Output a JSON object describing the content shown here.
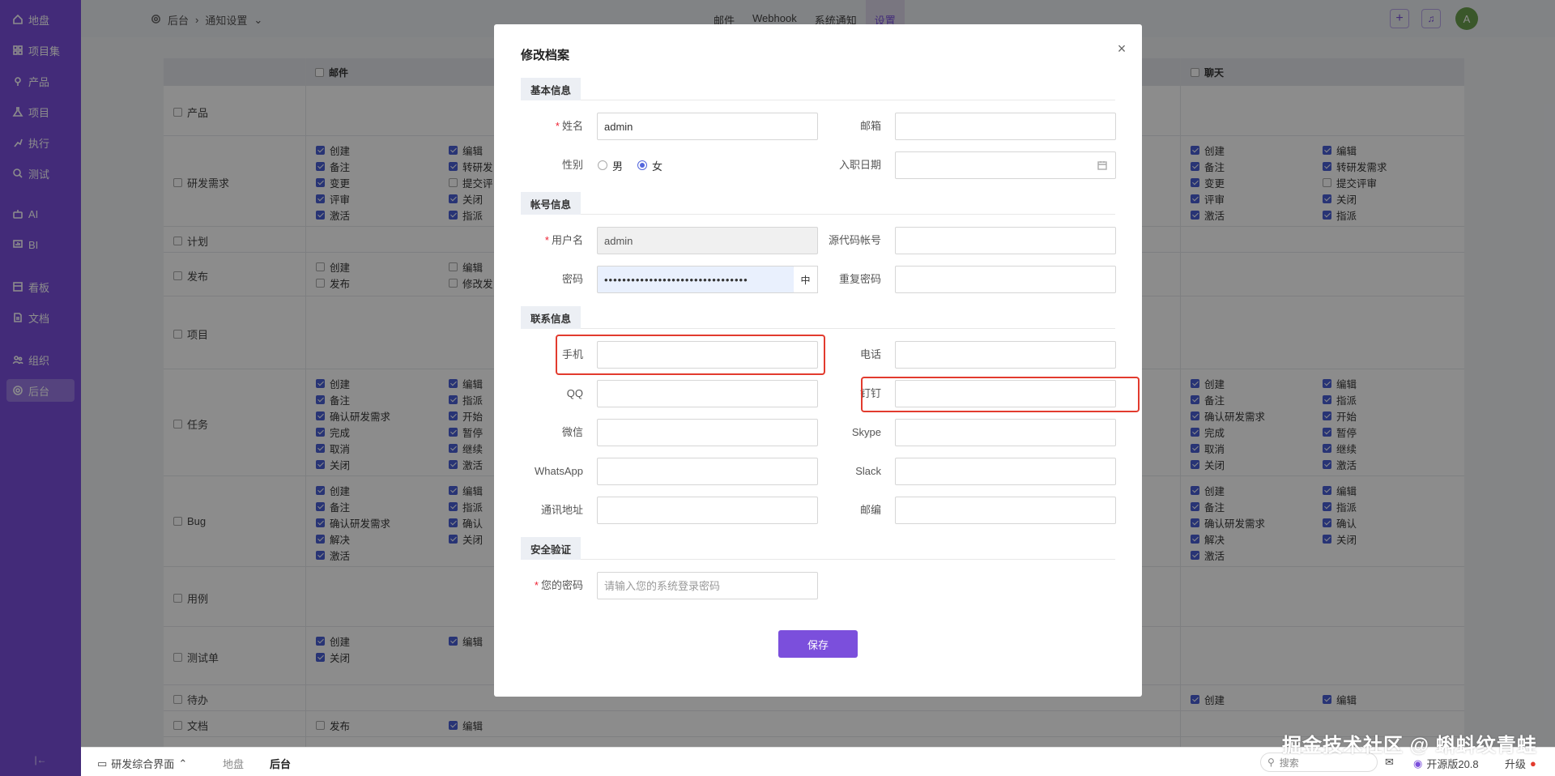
{
  "sidebar": {
    "items": [
      {
        "label": "地盘",
        "icon": "home-icon"
      },
      {
        "label": "项目集",
        "icon": "grid-icon"
      },
      {
        "label": "产品",
        "icon": "pin-icon"
      },
      {
        "label": "项目",
        "icon": "flask-icon"
      },
      {
        "label": "执行",
        "icon": "run-icon"
      },
      {
        "label": "测试",
        "icon": "search-icon"
      },
      {
        "label": "AI",
        "icon": "robot-icon"
      },
      {
        "label": "BI",
        "icon": "chart-icon"
      },
      {
        "label": "看板",
        "icon": "board-icon"
      },
      {
        "label": "文档",
        "icon": "doc-icon"
      },
      {
        "label": "组织",
        "icon": "users-icon"
      },
      {
        "label": "后台",
        "icon": "gear-icon"
      }
    ],
    "collapse": "|←"
  },
  "header": {
    "breadcrumb_root": "后台",
    "breadcrumb_current": "通知设置",
    "tabs": [
      "邮件",
      "Webhook",
      "系统通知",
      "设置"
    ],
    "avatar": "A"
  },
  "matrix": {
    "columns": [
      "邮件",
      "聊天"
    ],
    "rows": [
      {
        "label": "产品"
      },
      {
        "label": "研发需求"
      },
      {
        "label": "计划"
      },
      {
        "label": "发布"
      },
      {
        "label": "项目"
      },
      {
        "label": "任务"
      },
      {
        "label": "Bug"
      },
      {
        "label": "用例"
      },
      {
        "label": "测试单"
      },
      {
        "label": "待办"
      },
      {
        "label": "文档"
      }
    ],
    "story_col1": [
      "创建",
      "备注",
      "变更",
      "评审",
      "激活"
    ],
    "story_col2": [
      "编辑",
      "转研发需求",
      "提交评审",
      "关闭",
      "指派"
    ],
    "story_col2_short": [
      "编辑",
      "转研发",
      "提交评",
      "关闭",
      "指派"
    ],
    "release_col1": [
      "创建",
      "发布"
    ],
    "release_col2": [
      "编辑",
      "修改发"
    ],
    "task_col1": [
      "创建",
      "备注",
      "确认研发需求",
      "完成",
      "取消",
      "关闭"
    ],
    "task_col2": [
      "编辑",
      "指派",
      "开始",
      "暂停",
      "继续",
      "激活"
    ],
    "bug_col1": [
      "创建",
      "备注",
      "确认研发需求",
      "解决",
      "激活"
    ],
    "bug_col2": [
      "编辑",
      "指派",
      "确认",
      "关闭"
    ],
    "testtask_col1": [
      "创建",
      "关闭"
    ],
    "testtask_col2": [
      "编辑"
    ],
    "todo_col1": [
      "创建"
    ],
    "todo_col2": [
      "编辑"
    ],
    "doc_col1": [
      "发布"
    ],
    "doc_col2": [
      "编辑"
    ]
  },
  "modal": {
    "title": "修改档案",
    "close": "×",
    "sections": {
      "basic": "基本信息",
      "account": "帐号信息",
      "contact": "联系信息",
      "security": "安全验证"
    },
    "fields": {
      "name_label": "姓名",
      "name_value": "admin",
      "email_label": "邮箱",
      "email_value": "",
      "gender_label": "性别",
      "gender_male": "男",
      "gender_female": "女",
      "join_date_label": "入职日期",
      "join_date_value": "",
      "username_label": "用户名",
      "username_value": "admin",
      "scm_label": "源代码帐号",
      "scm_value": "",
      "password_label": "密码",
      "password_value": "••••••••••••••••••••••••••••••••",
      "password_strength": "中",
      "repeat_password_label": "重复密码",
      "repeat_password_value": "",
      "mobile_label": "手机",
      "mobile_value": "",
      "phone_label": "电话",
      "phone_value": "",
      "qq_label": "QQ",
      "qq_value": "",
      "dingding_label": "钉钉",
      "dingding_value": "",
      "wechat_label": "微信",
      "wechat_value": "",
      "skype_label": "Skype",
      "skype_value": "",
      "whatsapp_label": "WhatsApp",
      "whatsapp_value": "",
      "slack_label": "Slack",
      "slack_value": "",
      "address_label": "通讯地址",
      "address_value": "",
      "zipcode_label": "邮编",
      "zipcode_value": "",
      "verify_label": "您的密码",
      "verify_placeholder": "请输入您的系统登录密码"
    },
    "save": "保存",
    "highlight_color": "#e23b2e"
  },
  "bottombar": {
    "app_switch": "研发综合界面",
    "crumb1": "地盘",
    "crumb2": "后台",
    "search_placeholder": "搜索",
    "version": "开源版20.8",
    "upgrade": "升级"
  },
  "watermark": "掘金技术社区 @ 蝌蚪纹青蛙",
  "colors": {
    "brand": "#7b4fdc",
    "checkbox": "#4a5fd6"
  }
}
